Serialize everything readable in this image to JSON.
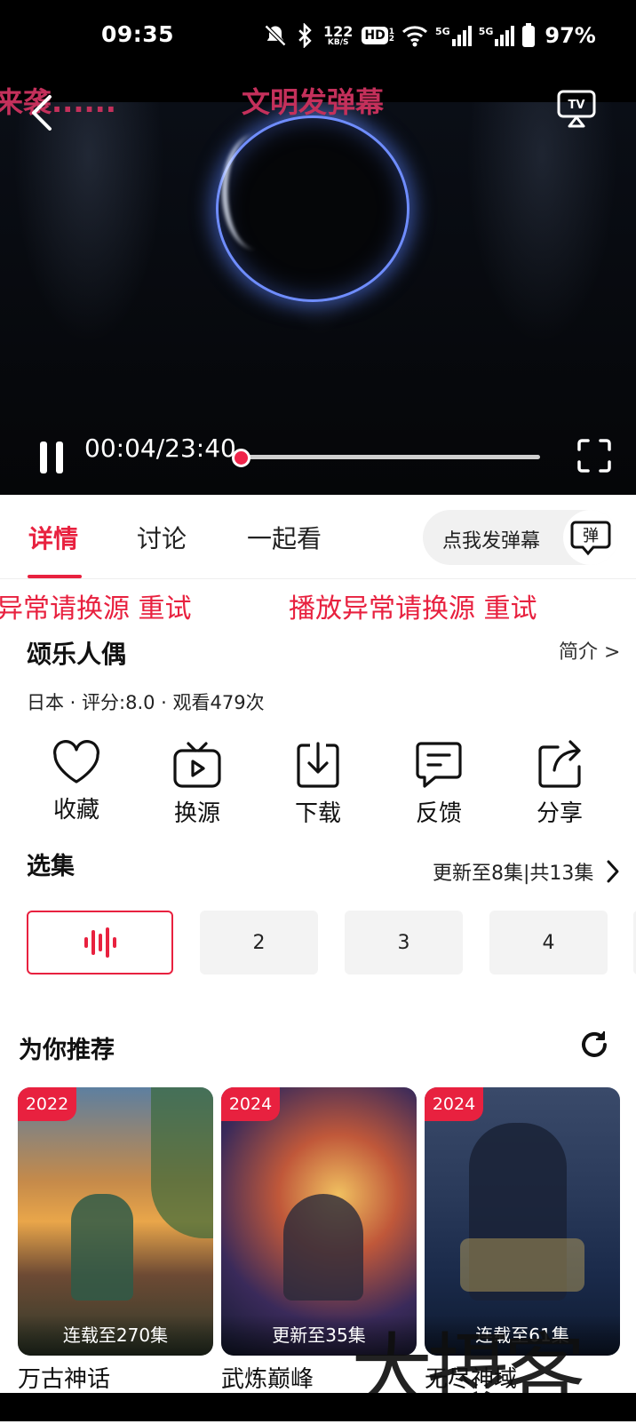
{
  "status_bar": {
    "time": "09:35",
    "net_speed": "122",
    "net_unit": "KB/S",
    "hd": "HD",
    "sig1": "5G",
    "sig2": "5G",
    "battery": "97%"
  },
  "video": {
    "danmaku_left": "来袭......",
    "danmaku_center": "文明发弹幕",
    "time_label": "00:04/23:40",
    "progress": 0.003
  },
  "tabs": [
    "详情",
    "讨论",
    "一起看"
  ],
  "danmaku_input": {
    "placeholder": "点我发弹幕",
    "icon_char": "弹"
  },
  "error_danmaku": [
    "异常请换源 重试",
    "播放异常请换源 重试"
  ],
  "show": {
    "title": "颂乐人偶",
    "intro": "简介 >",
    "meta": "日本 · 评分:8.0 · 观看479次"
  },
  "actions": [
    {
      "label": "收藏",
      "icon": "heart-icon"
    },
    {
      "label": "换源",
      "icon": "tv-play-icon"
    },
    {
      "label": "下载",
      "icon": "download-icon"
    },
    {
      "label": "反馈",
      "icon": "feedback-icon"
    },
    {
      "label": "分享",
      "icon": "share-icon"
    }
  ],
  "episodes": {
    "title": "选集",
    "info": "更新至8集|共13集",
    "items": [
      "2",
      "3",
      "4"
    ]
  },
  "recommend": {
    "title": "为你推荐",
    "cards": [
      {
        "year": "2022",
        "status": "连载至270集",
        "name": "万古神话"
      },
      {
        "year": "2024",
        "status": "更新至35集",
        "name": "武炼巅峰"
      },
      {
        "year": "2024",
        "status": "连载至61集",
        "name": "无尽神域"
      }
    ]
  },
  "watermark": "大摂客",
  "colors": {
    "accent": "#e8213f",
    "status_bar": "#000000",
    "chip_bg": "#f3f3f3"
  }
}
